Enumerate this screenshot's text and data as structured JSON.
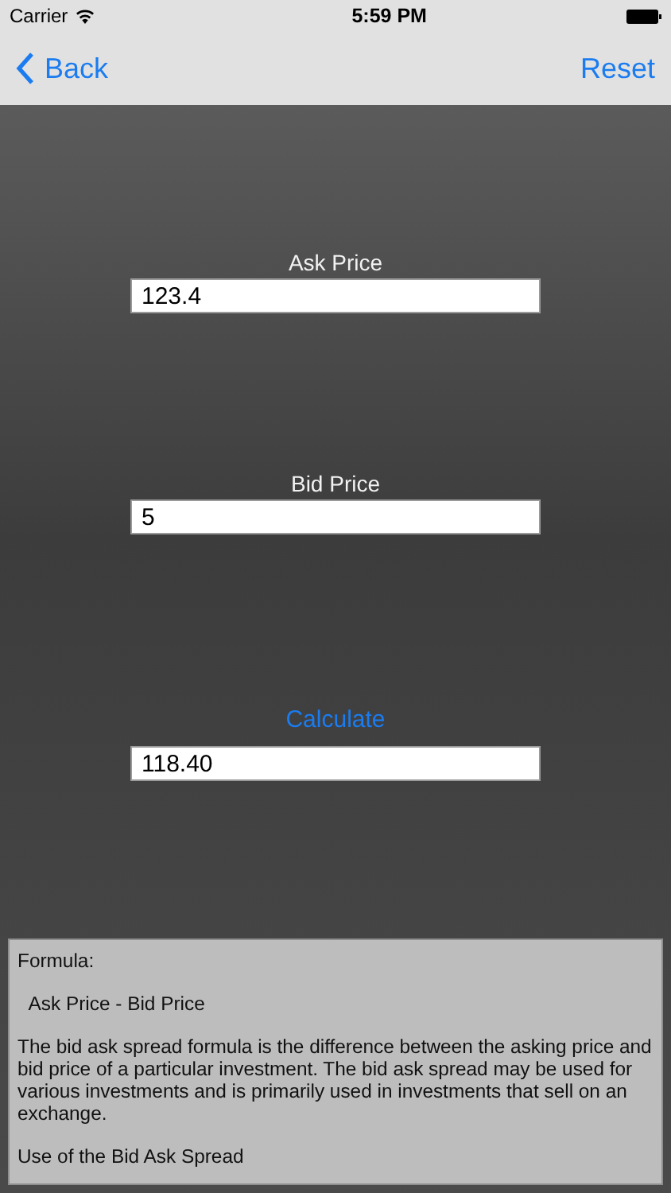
{
  "status_bar": {
    "carrier": "Carrier",
    "time": "5:59 PM"
  },
  "nav_bar": {
    "back": "Back",
    "action": "Reset"
  },
  "fields": [
    {
      "label": "Ask Price",
      "value": "123.4"
    },
    {
      "label": "Bid Price",
      "value": "5"
    }
  ],
  "calculate_button": "Calculate",
  "result": {
    "value": "118.40"
  },
  "info_text": [
    "Formula:",
    "  Ask Price - Bid Price",
    "The bid ask spread formula is the difference between the asking price and bid price of a particular investment. The bid ask spread may be used for various investments and is primarily used in investments that sell on an exchange.",
    "Use of the Bid Ask Spread"
  ]
}
